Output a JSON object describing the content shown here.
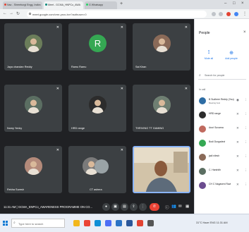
{
  "browser": {
    "tabs": [
      {
        "label": "Nav - Shreeburgi Engg. Indira"
      },
      {
        "label": "Meet - GCMA_HNPCo_AWA"
      },
      {
        "label": "G Whatsapp"
      }
    ],
    "address": "meet.google.com/vmr-ysro-bvr?authuser=0"
  },
  "tiles": [
    {
      "name": "Jaya chandan Reddy",
      "avatar": "photo",
      "muted": true,
      "color": "#6b7d5a"
    },
    {
      "name": "Ramu Ramu",
      "avatar": "letter",
      "letter": "R",
      "muted": true,
      "color": "#35a853"
    },
    {
      "name": "Sai Kiran",
      "avatar": "photo",
      "muted": true,
      "color": "#8a6a58"
    },
    {
      "name": "Nomy Yenky",
      "avatar": "photo",
      "muted": true,
      "color": "#5b6e62"
    },
    {
      "name": "HRD range",
      "avatar": "photo",
      "muted": true,
      "color": "#2c2c2c"
    },
    {
      "name": "THRIVING TT GAMING",
      "avatar": "photo",
      "muted": true,
      "color": "#6f7f72"
    },
    {
      "name": "Rekha Suresh",
      "avatar": "photo",
      "muted": true,
      "color": "#b38a7a"
    },
    {
      "name": "CT ashera",
      "avatar": "photo",
      "muted": true,
      "color": "#7a7a7a"
    }
  ],
  "meeting": {
    "time": "11:31 AM",
    "title": "GCMA_ENPCo_AWARENESS PROGRAMME ON CO..."
  },
  "people_panel": {
    "title": "People",
    "actions": [
      {
        "label": "Mute all",
        "icon": "mute-icon"
      },
      {
        "label": "Add people",
        "icon": "add-person-icon"
      }
    ],
    "search_placeholder": "Search for people",
    "section": "In call",
    "participants": [
      {
        "name": "B Sudheer Reddy (You)",
        "sub": "Meeting host",
        "color": "#2e6da4"
      },
      {
        "name": "HRD range",
        "sub": "",
        "color": "#2c2c2c"
      },
      {
        "name": "Aruri Suvarna",
        "sub": "",
        "color": "#c06a5f"
      },
      {
        "name": "Bodi Durgadevi",
        "sub": "",
        "color": "#35a853"
      },
      {
        "name": "jadi nilesh",
        "sub": "",
        "color": "#8a6a58"
      },
      {
        "name": "C. Harshith",
        "sub": "",
        "color": "#5b6e62"
      },
      {
        "name": "CH C Nagaveni Ravi",
        "sub": "",
        "color": "#6b4c8f"
      }
    ]
  },
  "taskbar": {
    "search_placeholder": "Type here to search",
    "tray_text": "31°C Haze  ENG  11:31 AM",
    "apps": [
      {
        "icon": "file-explorer-icon",
        "color": "#f2b71c"
      },
      {
        "icon": "chrome-icon",
        "color": "#ea4335"
      },
      {
        "icon": "edge-icon",
        "color": "#0f8fd6"
      },
      {
        "icon": "store-icon",
        "color": "#4c6ef5"
      },
      {
        "icon": "mail-icon",
        "color": "#2b73c4"
      },
      {
        "icon": "word-icon",
        "color": "#2b579a"
      },
      {
        "icon": "photos-icon",
        "color": "#e24333"
      },
      {
        "icon": "settings-icon",
        "color": "#555"
      }
    ]
  }
}
